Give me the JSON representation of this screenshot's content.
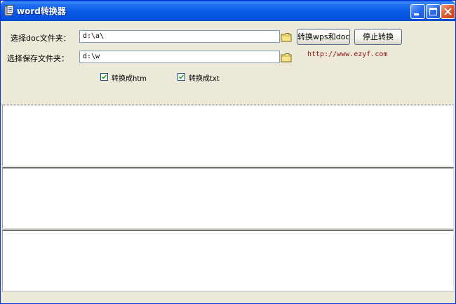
{
  "window": {
    "title": "word转换器",
    "icon": "app-icon"
  },
  "form": {
    "doc_folder_label": "选择doc文件夹：",
    "doc_folder_value": "d:\\a\\",
    "save_folder_label": "选择保存文件夹：",
    "save_folder_value": "d:\\w",
    "convert_button": "转换wps和doc",
    "stop_button": "停止转换",
    "link": "http://www.ezyf.com",
    "checkbox_htm": {
      "label": "转换成htm",
      "checked": true
    },
    "checkbox_txt": {
      "label": "转换成txt",
      "checked": true
    }
  },
  "colors": {
    "titlebar": "#0757e4",
    "face": "#ece9d8",
    "link": "#8b1010"
  }
}
